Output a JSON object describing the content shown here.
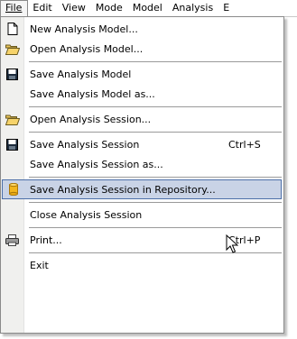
{
  "menubar": {
    "items": [
      {
        "label": "File",
        "active": true
      },
      {
        "label": "Edit"
      },
      {
        "label": "View"
      },
      {
        "label": "Mode"
      },
      {
        "label": "Model"
      },
      {
        "label": "Analysis"
      },
      {
        "label": "E"
      }
    ]
  },
  "file_menu": {
    "items": [
      {
        "label": "New Analysis Model...",
        "icon": "new-document-icon"
      },
      {
        "label": "Open Analysis Model...",
        "icon": "open-folder-icon"
      },
      {
        "label": "Save Analysis Model",
        "icon": "floppy-disk-icon"
      },
      {
        "label": "Save Analysis Model as..."
      },
      {
        "label": "Open Analysis Session...",
        "icon": "open-folder-icon"
      },
      {
        "label": "Save Analysis Session",
        "icon": "floppy-disk-icon",
        "shortcut": "Ctrl+S"
      },
      {
        "label": "Save Analysis Session as..."
      },
      {
        "label": "Save Analysis Session in Repository...",
        "icon": "database-cylinder-icon",
        "highlighted": true
      },
      {
        "label": "Close Analysis Session"
      },
      {
        "label": "Print...",
        "icon": "printer-icon",
        "shortcut": "Ctrl+P"
      },
      {
        "label": "Exit"
      }
    ]
  },
  "colors": {
    "highlight_fill": "#c9d3e6",
    "highlight_border": "#4c6fa8",
    "icon_strip": "#f0f0ee"
  }
}
